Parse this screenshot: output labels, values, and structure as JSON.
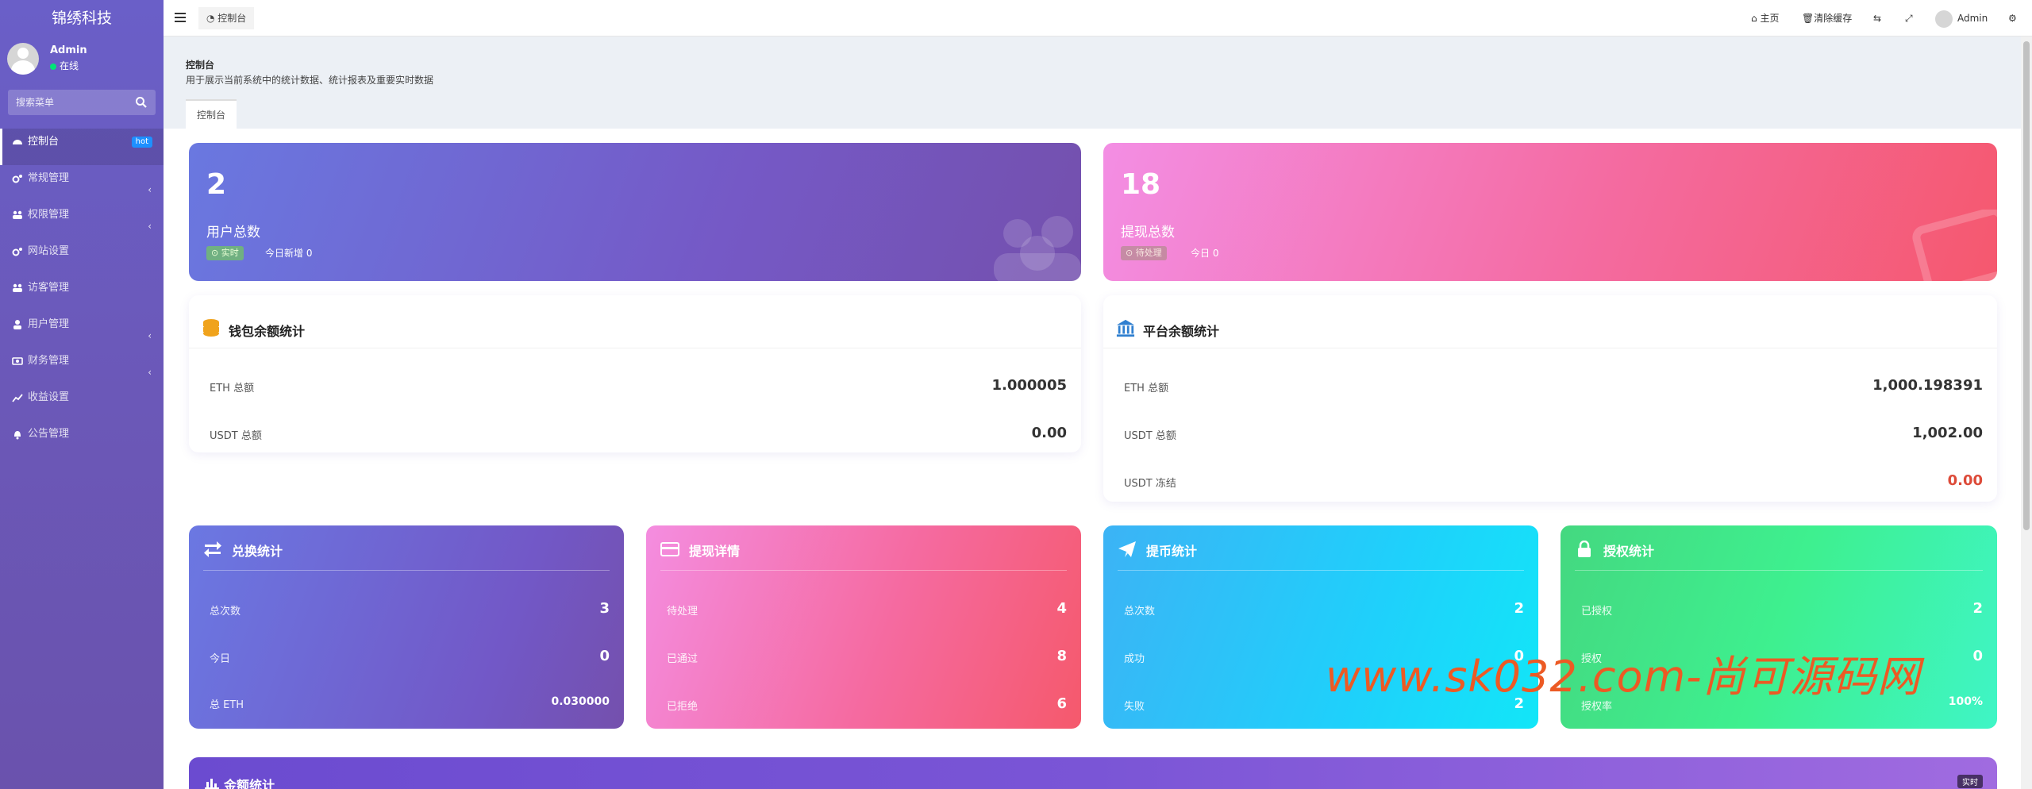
{
  "app": {
    "brand": "锦绣科技"
  },
  "user": {
    "name": "Admin",
    "status": "在线"
  },
  "sidebar": {
    "search_placeholder": "搜索菜单",
    "items": [
      {
        "label": "控制台",
        "badge": "hot"
      },
      {
        "label": "常规管理"
      },
      {
        "label": "权限管理"
      },
      {
        "label": "网站设置"
      },
      {
        "label": "访客管理"
      },
      {
        "label": "用户管理"
      },
      {
        "label": "财务管理"
      },
      {
        "label": "收益设置"
      },
      {
        "label": "公告管理"
      }
    ]
  },
  "header": {
    "tab": "控制台",
    "home": "主页",
    "clear_cache": "清除缓存",
    "user": "Admin"
  },
  "breadcrumb": {
    "title": "控制台",
    "subtitle": "用于展示当前系统中的统计数据、统计报表及重要实时数据",
    "tab": "控制台"
  },
  "cards": {
    "users": {
      "value": "2",
      "label": "用户总数",
      "chip": "实时",
      "today_label": "今日新增",
      "today_value": "0"
    },
    "withdraw": {
      "value": "18",
      "label": "提现总数",
      "chip": "待处理",
      "today_label": "今日",
      "today_value": "0"
    }
  },
  "wallet": {
    "title": "钱包余额统计",
    "rows": [
      {
        "label": "ETH 总额",
        "value": "1.000005"
      },
      {
        "label": "USDT 总额",
        "value": "0.00"
      }
    ]
  },
  "platform": {
    "title": "平台余额统计",
    "rows": [
      {
        "label": "ETH 总额",
        "value": "1,000.198391"
      },
      {
        "label": "USDT 总额",
        "value": "1,002.00"
      },
      {
        "label": "USDT 冻结",
        "value": "0.00"
      }
    ]
  },
  "stats": {
    "exchange": {
      "title": "兑换统计",
      "rows": [
        {
          "label": "总次数",
          "value": "3"
        },
        {
          "label": "今日",
          "value": "0"
        },
        {
          "label": "总 ETH",
          "value": "0.030000"
        }
      ]
    },
    "withdraw": {
      "title": "提现详情",
      "rows": [
        {
          "label": "待处理",
          "value": "4"
        },
        {
          "label": "已通过",
          "value": "8"
        },
        {
          "label": "已拒绝",
          "value": "6"
        }
      ]
    },
    "coin": {
      "title": "提币统计",
      "rows": [
        {
          "label": "总次数",
          "value": "2"
        },
        {
          "label": "成功",
          "value": "0"
        },
        {
          "label": "失败",
          "value": "2"
        }
      ]
    },
    "auth": {
      "title": "授权统计",
      "rows": [
        {
          "label": "已授权",
          "value": "2"
        },
        {
          "label": "授权",
          "value": "0"
        },
        {
          "label": "授权率",
          "value": "100%"
        }
      ]
    }
  },
  "amount": {
    "title": "金额统计",
    "badge": "实时"
  },
  "watermark": "www.sk032.com-尚可源码网",
  "colors": {
    "accent": "#6c5fd0",
    "danger": "#dd4b39",
    "hot": "#1e90ff"
  }
}
